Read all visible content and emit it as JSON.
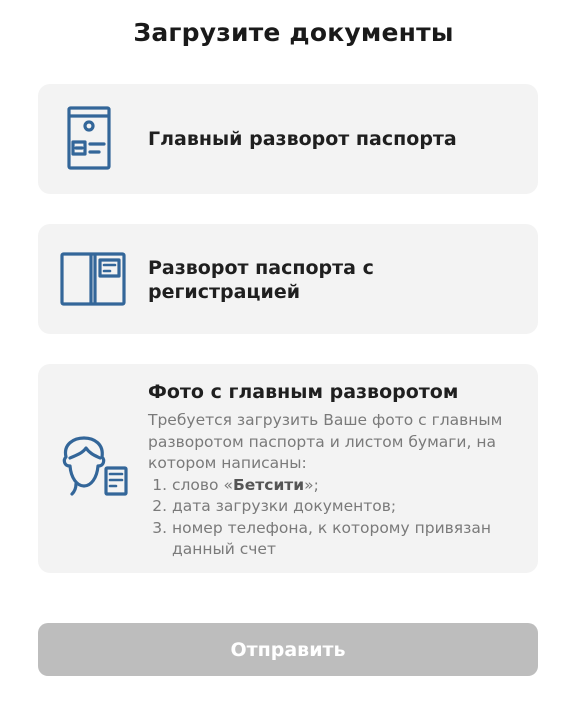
{
  "page": {
    "title": "Загрузите документы"
  },
  "colors": {
    "icon": "#336699",
    "card_bg": "#f3f3f3",
    "button_disabled": "#bdbdbd",
    "desc_text": "#7a7a7a"
  },
  "cards": [
    {
      "icon": "passport-main-page-icon",
      "title": "Главный разворот паспорта"
    },
    {
      "icon": "passport-registration-spread-icon",
      "title": "Разворот паспорта с регистрацией"
    },
    {
      "icon": "person-with-document-icon",
      "title": "Фото с главным разворотом",
      "description": "Требуется загрузить Ваше фото с главным разворотом паспорта и листом бумаги, на котором написаны:",
      "list": [
        {
          "prefix": "слово «",
          "bold": "Бетсити",
          "suffix": "»;"
        },
        {
          "text": "дата загрузки документов;"
        },
        {
          "text": "номер телефона, к которому привязан данный счет"
        }
      ]
    }
  ],
  "submit": {
    "label": "Отправить",
    "enabled": false
  }
}
